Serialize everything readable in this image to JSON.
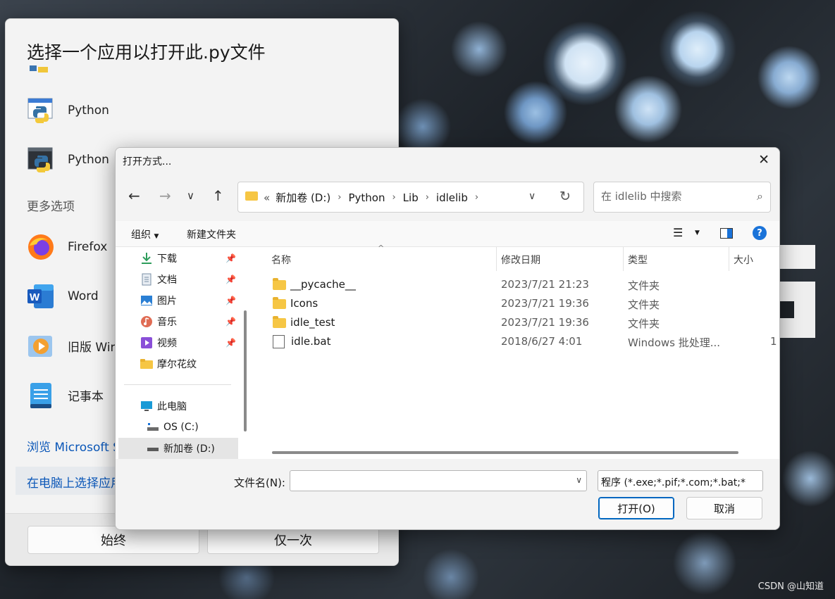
{
  "watermark": "CSDN @山知道",
  "app_dialog": {
    "title": "选择一个应用以打开此.py文件",
    "apps": [
      {
        "label": "Python",
        "icon": "python-file-icon"
      },
      {
        "label": "Python",
        "icon": "python-console-icon"
      }
    ],
    "more_options": "更多选项",
    "more_apps": [
      {
        "label": "Firefox",
        "icon": "firefox-icon"
      },
      {
        "label": "Word",
        "icon": "word-icon"
      },
      {
        "label": "旧版 Win",
        "icon": "media-player-icon"
      },
      {
        "label": "记事本",
        "icon": "notepad-icon"
      }
    ],
    "store_link": "浏览 Microsoft S",
    "pc_link": "在电脑上选择应用",
    "always_button": "始终",
    "once_button": "仅一次"
  },
  "file_dialog": {
    "title": "打开方式...",
    "breadcrumb": [
      "新加卷 (D:)",
      "Python",
      "Lib",
      "idlelib"
    ],
    "breadcrumb_overflow": "«",
    "search_placeholder": "在 idlelib 中搜索",
    "toolbar": {
      "organize": "组织",
      "new_folder": "新建文件夹"
    },
    "nav": {
      "quick_access": [
        {
          "label": "下载",
          "icon": "download-icon",
          "color": "#2e9d5c"
        },
        {
          "label": "文档",
          "icon": "document-icon",
          "color": "#7a8fa6"
        },
        {
          "label": "图片",
          "icon": "pictures-icon",
          "color": "#2a7fd4"
        },
        {
          "label": "音乐",
          "icon": "music-icon",
          "color": "#e06c54"
        },
        {
          "label": "视频",
          "icon": "video-icon",
          "color": "#8a4fd8"
        },
        {
          "label": "摩尔花纹",
          "icon": "folder-icon",
          "color": "#f6c644"
        }
      ],
      "this_pc": "此电脑",
      "drives": [
        "OS (C:)",
        "新加卷 (D:)"
      ]
    },
    "columns": {
      "name": "名称",
      "date": "修改日期",
      "type": "类型",
      "size": "大小"
    },
    "files": [
      {
        "name": "__pycache__",
        "date": "2023/7/21 21:23",
        "type": "文件夹",
        "size": "",
        "kind": "folder"
      },
      {
        "name": "Icons",
        "date": "2023/7/21 19:36",
        "type": "文件夹",
        "size": "",
        "kind": "folder"
      },
      {
        "name": "idle_test",
        "date": "2023/7/21 19:36",
        "type": "文件夹",
        "size": "",
        "kind": "folder"
      },
      {
        "name": "idle.bat",
        "date": "2018/6/27 4:01",
        "type": "Windows 批处理...",
        "size": "1",
        "kind": "bat"
      }
    ],
    "filename_label": "文件名(N):",
    "filename_value": "",
    "filetype": "程序 (*.exe;*.pif;*.com;*.bat;*",
    "open_button": "打开(O)",
    "cancel_button": "取消"
  }
}
